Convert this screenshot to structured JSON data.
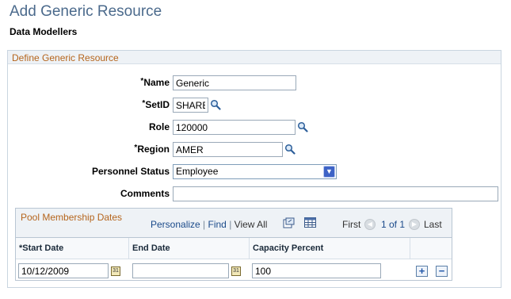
{
  "page": {
    "title": "Add Generic Resource",
    "subtitle": "Data Modellers"
  },
  "group": {
    "title": "Define Generic Resource"
  },
  "fields": {
    "name_label": "Name",
    "name_value": "Generic",
    "setid_label": "SetID",
    "setid_value": "SHARE",
    "role_label": "Role",
    "role_value": "120000",
    "region_label": "Region",
    "region_value": "AMER",
    "personnel_status_label": "Personnel Status",
    "personnel_status_value": "Employee",
    "comments_label": "Comments",
    "comments_value": "",
    "required_marker": "*"
  },
  "grid": {
    "title": "Pool Membership Dates",
    "personalize": "Personalize",
    "find": "Find",
    "separator": "|",
    "view_all": "View All",
    "first": "First",
    "pagination": "1 of 1",
    "last": "Last",
    "columns": {
      "start_date": "Start Date",
      "end_date": "End Date",
      "capacity_percent": "Capacity Percent"
    },
    "rows": [
      {
        "start_date": "10/12/2009",
        "end_date": "",
        "capacity_percent": "100"
      }
    ],
    "add_symbol": "+",
    "remove_symbol": "−",
    "calendar_glyph": "31"
  }
}
